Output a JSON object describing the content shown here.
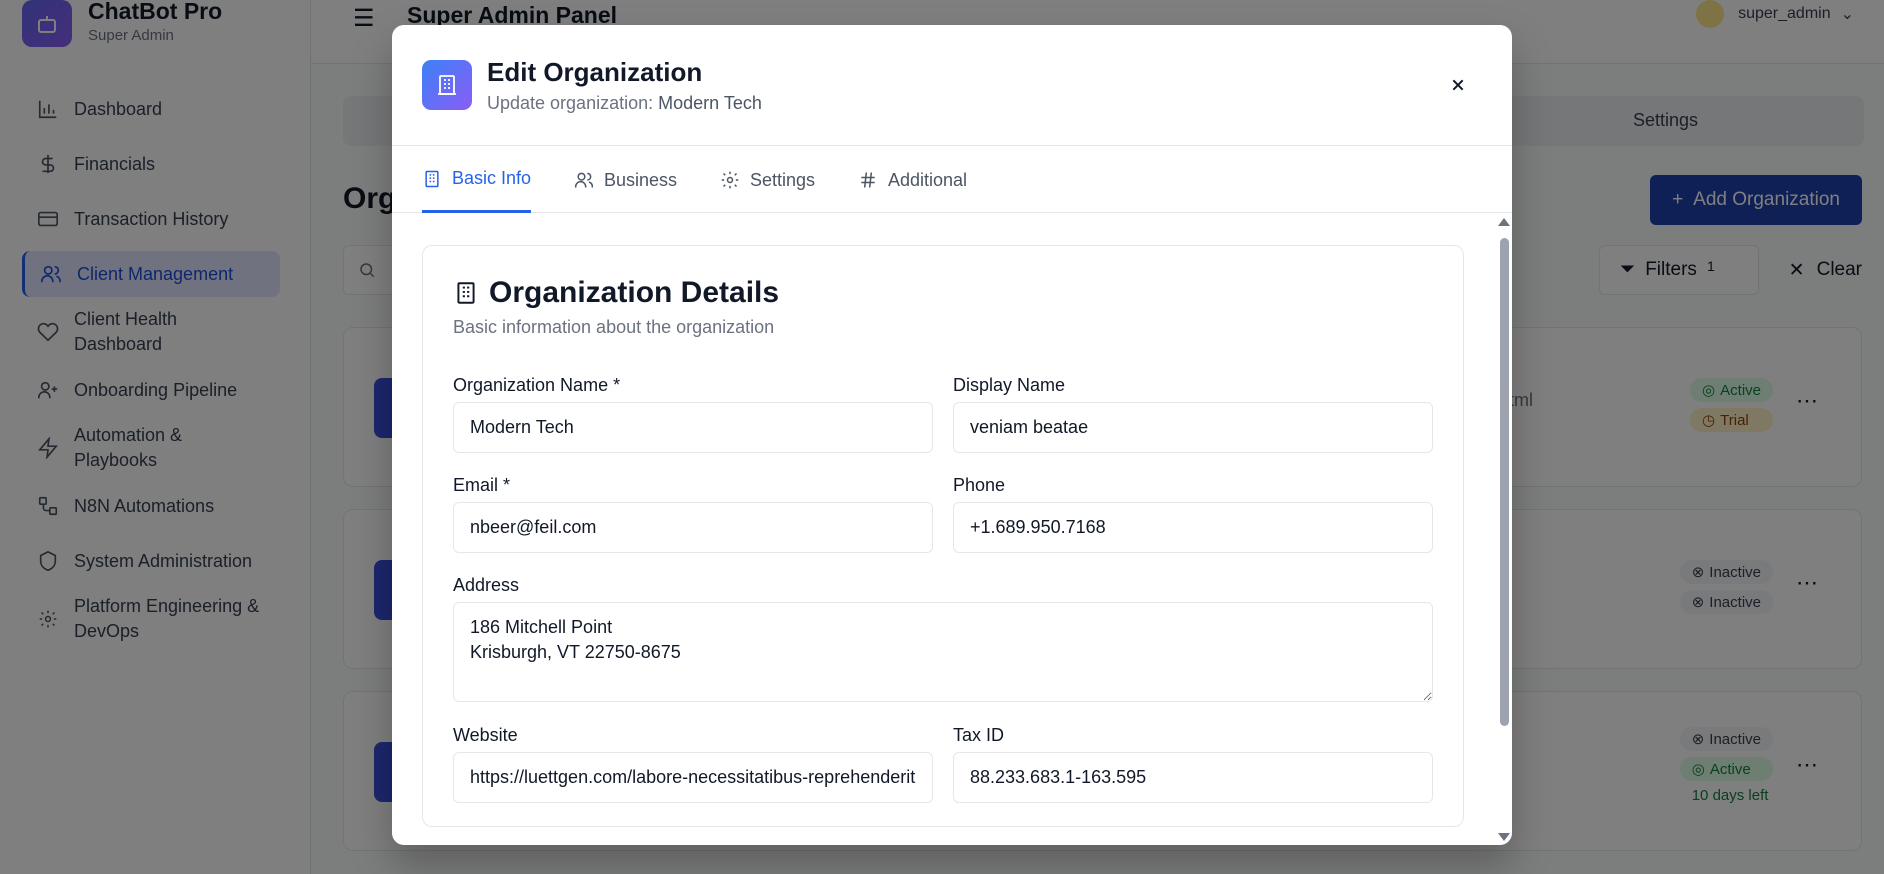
{
  "app": {
    "name": "ChatBot Pro",
    "role": "Super Admin"
  },
  "topbar": {
    "title": "Super Admin Panel",
    "username": "super_admin"
  },
  "sidebar": {
    "items": [
      {
        "label": "Dashboard",
        "icon": "bar-chart-icon"
      },
      {
        "label": "Financials",
        "icon": "dollar-icon"
      },
      {
        "label": "Transaction History",
        "icon": "credit-card-icon"
      },
      {
        "label": "Client Management",
        "icon": "users-icon",
        "active": true
      },
      {
        "label": "Client Health Dashboard",
        "icon": "heart-icon"
      },
      {
        "label": "Onboarding Pipeline",
        "icon": "user-plus-icon"
      },
      {
        "label": "Automation & Playbooks",
        "icon": "zap-icon"
      },
      {
        "label": "N8N Automations",
        "icon": "workflow-icon"
      },
      {
        "label": "System Administration",
        "icon": "shield-icon"
      },
      {
        "label": "Platform Engineering & DevOps",
        "icon": "gear-icon"
      }
    ]
  },
  "main": {
    "heading_fragment": "Org",
    "tab_settings": "Settings",
    "add_button": "Add Organization",
    "filters_label": "Filters",
    "filters_count": "1",
    "clear_label": "Clear",
    "url_fragment": "tml",
    "rows": [
      {
        "badges": [
          {
            "text": "Active",
            "type": "active"
          },
          {
            "text": "Trial",
            "type": "trial"
          }
        ]
      },
      {
        "badges": [
          {
            "text": "Inactive",
            "type": "inactive"
          },
          {
            "text": "Inactive",
            "type": "inactive"
          }
        ]
      },
      {
        "badges": [
          {
            "text": "Inactive",
            "type": "inactive"
          },
          {
            "text": "Active",
            "type": "active"
          }
        ],
        "note": "10 days left"
      }
    ]
  },
  "modal": {
    "title": "Edit Organization",
    "subtitle_prefix": "Update organization: ",
    "subtitle_name": "Modern Tech",
    "tabs": [
      {
        "label": "Basic Info",
        "icon": "building-icon",
        "active": true
      },
      {
        "label": "Business",
        "icon": "users-icon"
      },
      {
        "label": "Settings",
        "icon": "gear-icon"
      },
      {
        "label": "Additional",
        "icon": "hash-icon"
      }
    ],
    "section": {
      "title": "Organization Details",
      "description": "Basic information about the organization"
    },
    "fields": {
      "org_name": {
        "label": "Organization Name *",
        "value": "Modern Tech"
      },
      "display_name": {
        "label": "Display Name",
        "value": "veniam beatae"
      },
      "email": {
        "label": "Email *",
        "value": "nbeer@feil.com"
      },
      "phone": {
        "label": "Phone",
        "value": "+1.689.950.7168"
      },
      "address": {
        "label": "Address",
        "value": "186 Mitchell Point\nKrisburgh, VT 22750-8675"
      },
      "website": {
        "label": "Website",
        "value": "https://luettgen.com/labore-necessitatibus-reprehenderit"
      },
      "tax_id": {
        "label": "Tax ID",
        "value": "88.233.683.1-163.595"
      }
    }
  }
}
